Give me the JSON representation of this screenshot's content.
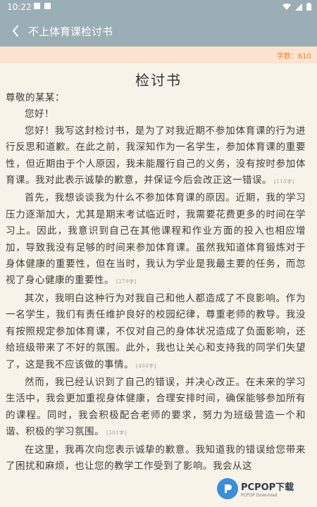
{
  "status": {
    "time": "10:22"
  },
  "appbar": {
    "title": "不上体育课检讨书"
  },
  "counter": {
    "text": "字数：610"
  },
  "document": {
    "title": "检讨书",
    "salutation": "尊敬的某某：",
    "greeting": "您好！",
    "paragraphs": [
      {
        "text": "您好！我写这封检讨书，是为了对我近期不参加体育课的行为进行反思和道歉。在此之前，我深知作为一名学生，参加体育课的重要性，但近期由于个人原因，我未能履行自己的义务，没有按时参加体育课。我对此表示诚挚的歉意，并保证今后会改正这一错误。",
        "tag": "[115字]"
      },
      {
        "text": "首先，我想谈谈我为什么不参加体育课的原因。近期，我的学习压力逐渐加大，尤其是期末考试临近时，我需要花费更多的时间在学习上。因此，我意识到自己在其他课程和作业方面的投入也相应增加，导致我没有足够的时间来参加体育课。虽然我知道体育锻炼对于身体健康的重要性，但在当时，我认为学业是我最主要的任务，而忽视了身心健康的重要性。",
        "tag": "[279字]"
      },
      {
        "text": "其次，我明白这种行为对我自己和他人都造成了不良影响。作为一名学生，我们有责任维护良好的校园纪律，尊重老师的教导。我没有按照规定参加体育课，不仅对自己的身体状况造成了负面影响，还给班级带来了不好的氛围。此外，我也让关心和支持我的同学们失望了，这是我不应该做的事情。",
        "tag": "[404字]"
      },
      {
        "text": "然而，我已经认识到了自己的错误，并决心改正。在未来的学习生活中，我会更加重视身体健康，合理安排时间，确保能够参加所有的课程。同时，我会积极配合老师的要求，努力为班级营造一个和谐、积极的学习氛围。",
        "tag": "[501字]"
      },
      {
        "text": "在这里，我再次向您表示诚挚的歉意。我知道我的错误给您带来了困扰和麻烦，也让您的教学工作受到了影响。我会从这",
        "tag": ""
      }
    ]
  },
  "watermark": {
    "main": "PCPOP下载",
    "sub": "PCPOP Download"
  }
}
